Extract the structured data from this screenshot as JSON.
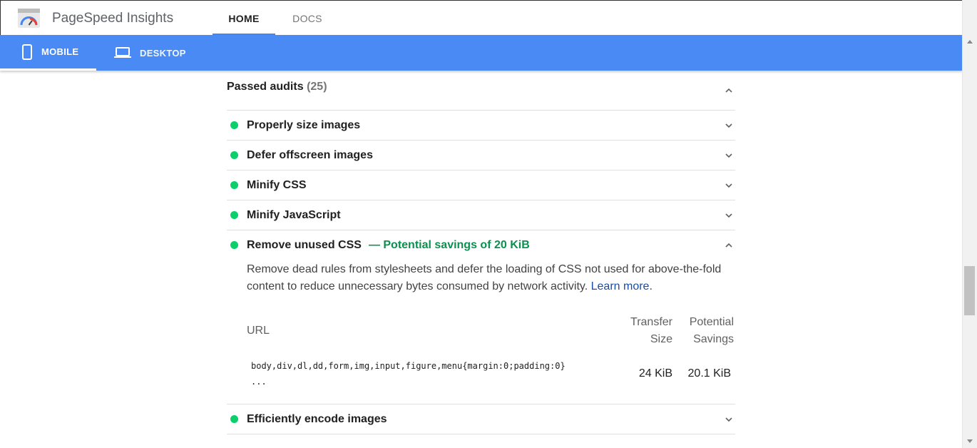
{
  "header": {
    "app_title": "PageSpeed Insights",
    "logo_icon": "pagespeed-gauge-icon",
    "tabs": [
      {
        "label": "HOME",
        "active": true
      },
      {
        "label": "DOCS",
        "active": false
      }
    ]
  },
  "device_bar": {
    "color": "#4a8af4",
    "tabs": [
      {
        "label": "MOBILE",
        "icon": "phone-icon",
        "active": true
      },
      {
        "label": "DESKTOP",
        "icon": "laptop-icon",
        "active": false
      }
    ]
  },
  "passed_audits": {
    "title": "Passed audits",
    "count": "(25)",
    "expanded": true,
    "audits": [
      {
        "title": "Properly size images",
        "status": "pass",
        "expanded": false
      },
      {
        "title": "Defer offscreen images",
        "status": "pass",
        "expanded": false
      },
      {
        "title": "Minify CSS",
        "status": "pass",
        "expanded": false
      },
      {
        "title": "Minify JavaScript",
        "status": "pass",
        "expanded": false
      },
      {
        "title": "Remove unused CSS",
        "status": "pass",
        "expanded": true,
        "savings": "— Potential savings of 20 KiB",
        "description": "Remove dead rules from stylesheets and defer the loading of CSS not used for above-the-fold content to reduce unnecessary bytes consumed by network activity.",
        "learn_more": "Learn more",
        "table": {
          "columns": {
            "url": "URL",
            "transfer_size": "Transfer Size",
            "potential_savings": "Potential Savings"
          },
          "rows": [
            {
              "url_line1": "body,div,dl,dd,form,img,input,figure,menu{margin:0;padding:0}",
              "url_line2": "...",
              "transfer_size": "24 KiB",
              "potential_savings": "20.1 KiB"
            }
          ]
        }
      },
      {
        "title": "Efficiently encode images",
        "status": "pass",
        "expanded": false
      }
    ]
  },
  "colors": {
    "pass_green": "#0cce6b",
    "savings_green": "#0d904f",
    "link_blue": "#1a4ca3",
    "accent_blue": "#4285f4"
  }
}
